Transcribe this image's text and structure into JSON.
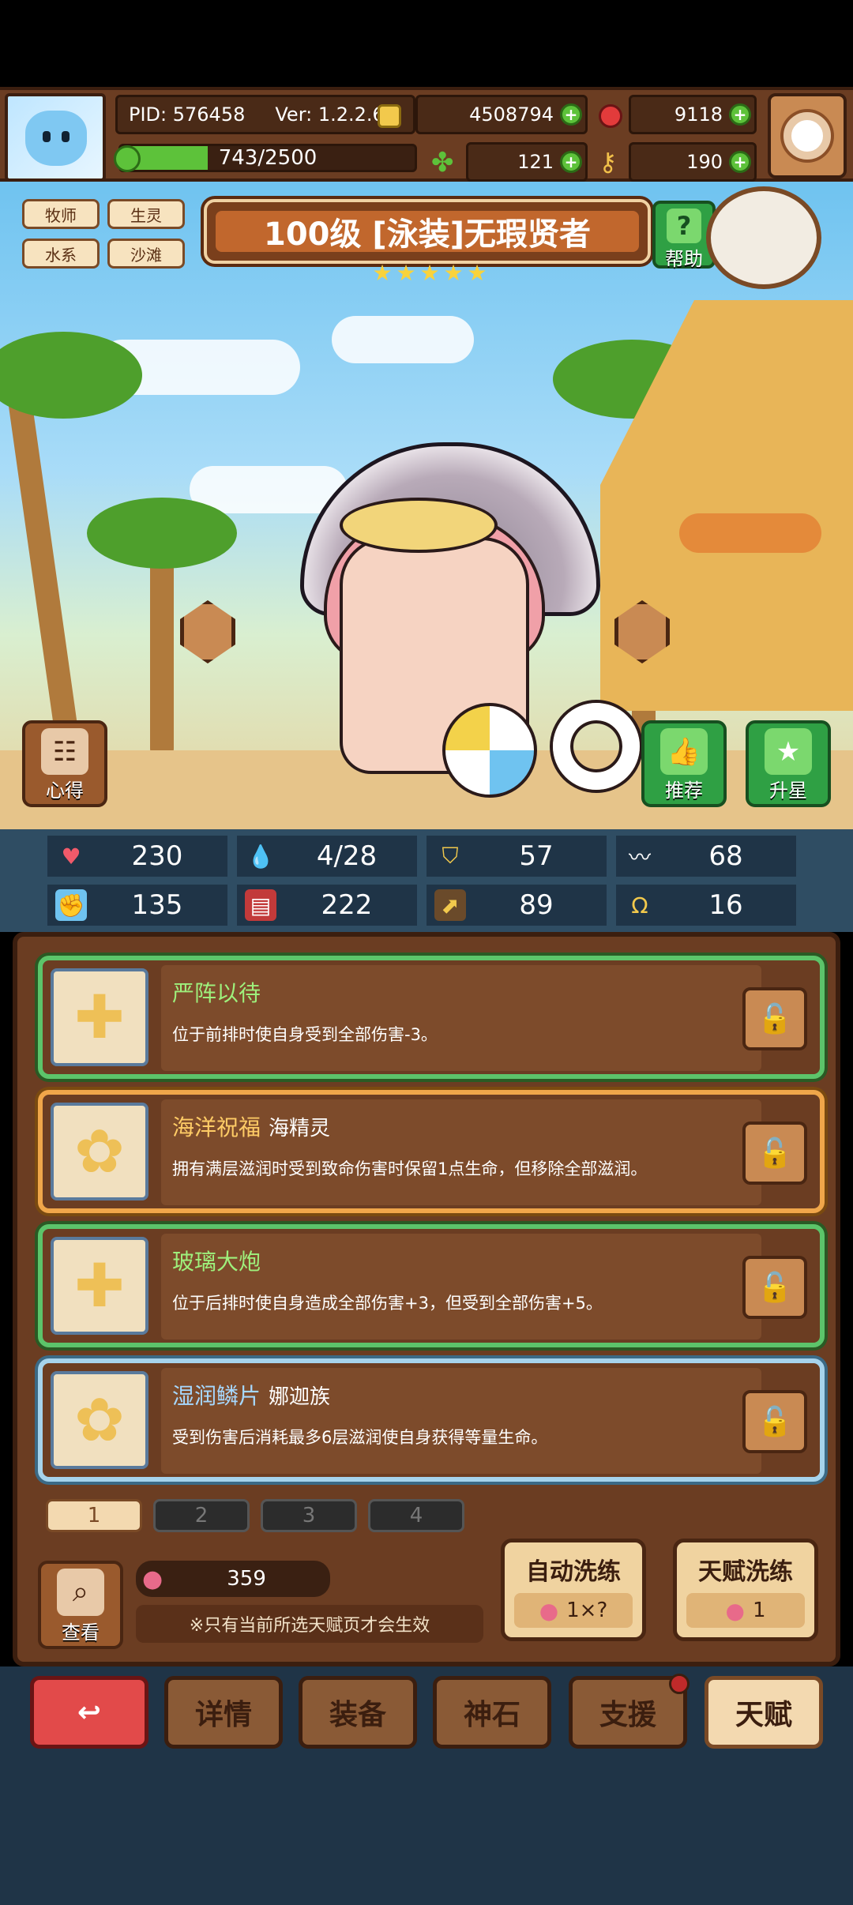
{
  "header": {
    "pid": "PID: 576458",
    "version": "Ver: 1.2.2.6",
    "gold": "4508794",
    "ruby": "9118",
    "exp": "743/2500",
    "exp_fraction": 0.297,
    "clover": "121",
    "key": "190",
    "colors": {
      "gold": "#f2c94c",
      "ruby": "#e23b3b",
      "clover": "#5dc23a",
      "key": "#f2c14a"
    }
  },
  "hero": {
    "tags": [
      "牧师",
      "生灵",
      "水系",
      "沙滩"
    ],
    "title": "100级 [泳装]无瑕贤者",
    "stars": 5,
    "help_label": "帮助",
    "left_button": "心得",
    "recommend_button": "推荐",
    "upgrade_button": "升星"
  },
  "stats": [
    {
      "icon": "heart-icon",
      "value": "230"
    },
    {
      "icon": "water-drop-icon",
      "value": "4/28"
    },
    {
      "icon": "shield-icon",
      "value": "57"
    },
    {
      "icon": "wing-icon",
      "value": "68"
    },
    {
      "icon": "fist-icon",
      "value": "135"
    },
    {
      "icon": "book-icon",
      "value": "222"
    },
    {
      "icon": "boot-icon",
      "value": "89"
    },
    {
      "icon": "horseshoe-icon",
      "value": "16"
    }
  ],
  "talents": [
    {
      "title": "严阵以待",
      "sub": "",
      "desc": "位于前排时使自身受到全部伤害-3。",
      "style": "green",
      "glyph": "✚"
    },
    {
      "title": "海洋祝福",
      "sub": "海精灵",
      "desc": "拥有满层滋润时受到致命伤害时保留1点生命，但移除全部滋润。",
      "style": "orange",
      "glyph": "✿"
    },
    {
      "title": "玻璃大炮",
      "sub": "",
      "desc": "位于后排时使自身造成全部伤害+3，但受到全部伤害+5。",
      "style": "green",
      "glyph": "✚"
    },
    {
      "title": "湿润鳞片",
      "sub": "娜迦族",
      "desc": "受到伤害后消耗最多6层滋润使自身获得等量生命。",
      "style": "blue",
      "glyph": "✿"
    }
  ],
  "pages": [
    "1",
    "2",
    "3",
    "4"
  ],
  "bottom_panel": {
    "search_label": "查看",
    "peach_count": "359",
    "note": "※只有当前所选天赋页才会生效",
    "auto_reroll": {
      "label": "自动洗练",
      "cost": "1×?"
    },
    "talent_reroll": {
      "label": "天赋洗练",
      "cost": "1"
    }
  },
  "nav": {
    "back": "↩",
    "items": [
      "详情",
      "装备",
      "神石",
      "支援",
      "天赋"
    ]
  }
}
